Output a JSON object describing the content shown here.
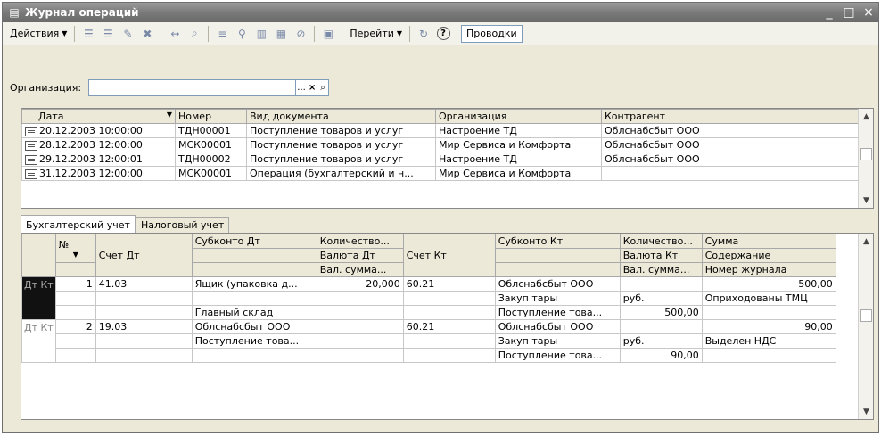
{
  "window": {
    "title": "Журнал операций",
    "min": "_",
    "max": "□",
    "close": "×"
  },
  "toolbar": {
    "actions_label": "Действия",
    "goto_label": "Перейти",
    "help_label": "?",
    "postings_label": "Проводки"
  },
  "filter": {
    "org_label": "Организация:",
    "org_value": "",
    "select_btn": "...",
    "clear_btn": "×",
    "search_btn": "⌕"
  },
  "journal": {
    "headers": [
      "Дата",
      "Номер",
      "Вид документа",
      "Организация",
      "Контрагент"
    ],
    "rows": [
      [
        "20.12.2003 10:00:00",
        "ТДН00001",
        "Поступление товаров и услуг",
        "Настроение ТД",
        "Облснабсбыт ООО"
      ],
      [
        "28.12.2003 12:00:00",
        "МСК00001",
        "Поступление товаров и услуг",
        "Мир Сервиса и Комфорта",
        "Облснабсбыт ООО"
      ],
      [
        "29.12.2003 12:00:01",
        "ТДН00002",
        "Поступление товаров и услуг",
        "Настроение ТД",
        "Облснабсбыт ООО"
      ],
      [
        "31.12.2003 12:00:00",
        "МСК00001",
        "Операция (бухгалтерский и н...",
        "Мир Сервиса и Комфорта",
        ""
      ]
    ]
  },
  "tabs": [
    "Бухгалтерский учет",
    "Налоговый учет"
  ],
  "postings": {
    "h1": [
      "№",
      "Счет Дт",
      "Субконто Дт",
      "Количество...",
      "Счет Кт",
      "Субконто Кт",
      "Количество...",
      "Сумма"
    ],
    "h2": [
      "Валюта Дт",
      "Валюта Кт",
      "Содержание"
    ],
    "h3": [
      "Вал. сумма...",
      "Вал. сумма...",
      "Номер журнала"
    ],
    "dtkt": "Дт Кт",
    "e1": {
      "num": "1",
      "acc_dt": "41.03",
      "sub_dt1": "Ящик (упаковка д...",
      "qty_dt": "20,000",
      "acc_kt": "60.21",
      "sub_kt1": "Облснабсбыт ООО",
      "sum": "500,00",
      "sub_kt2": "Закуп тары",
      "cur_kt": "руб.",
      "content": "Оприходованы ТМЦ",
      "sub_dt3": "Главный склад",
      "sub_kt3": "Поступление това...",
      "valsum_kt": "500,00"
    },
    "e2": {
      "num": "2",
      "acc_dt": "19.03",
      "sub_dt1": "Облснабсбыт ООО",
      "acc_kt": "60.21",
      "sub_kt1": "Облснабсбыт ООО",
      "sum": "90,00",
      "sub_dt2": "Поступление това...",
      "sub_kt2": "Закуп тары",
      "cur_kt": "руб.",
      "content": "Выделен НДС",
      "sub_kt3": "Поступление това...",
      "valsum_kt": "90,00"
    }
  }
}
